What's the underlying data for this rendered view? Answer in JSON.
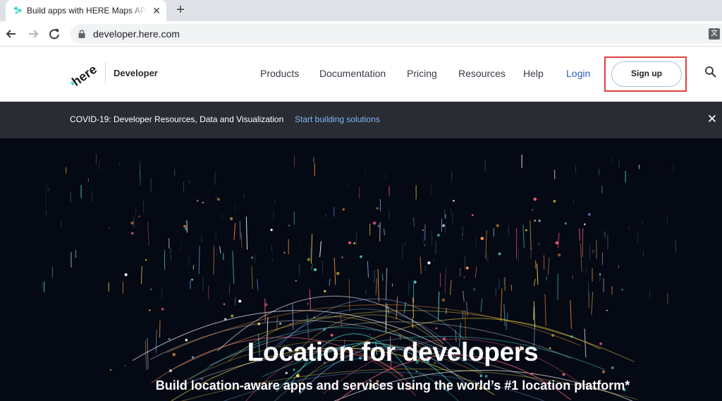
{
  "browser": {
    "tab_title": "Build apps with HERE Maps API",
    "tab_close": "✕",
    "new_tab": "+",
    "url": "developer.here.com",
    "translate_icon": "translate-icon"
  },
  "header": {
    "logo_text": "here",
    "brand": "Developer",
    "nav": [
      "Products",
      "Documentation",
      "Pricing",
      "Resources",
      "Help"
    ],
    "login": "Login",
    "signup": "Sign up",
    "search_icon": "search-icon"
  },
  "banner": {
    "message": "COVID-19: Developer Resources, Data and Visualization",
    "link": "Start building solutions",
    "close": "✕"
  },
  "hero": {
    "title": "Location for developers",
    "subtitle": "Build location-aware apps and services using the world’s #1 location platform*"
  },
  "colors": {
    "accent": "#2d5fb8",
    "highlight": "#e04040",
    "banner_bg": "#292d33",
    "hero_bg": "#050914",
    "brand_teal": "#48dad0"
  }
}
